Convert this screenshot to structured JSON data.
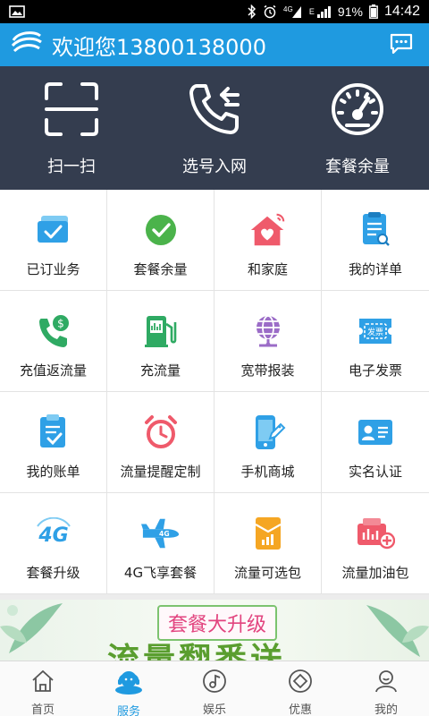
{
  "status_bar": {
    "battery_text": "91%",
    "time": "14:42",
    "signal_label": "4G",
    "network_letter": "E"
  },
  "header": {
    "title": "欢迎您13800138000"
  },
  "hero": {
    "items": [
      {
        "label": "扫一扫",
        "icon": "scan-icon"
      },
      {
        "label": "选号入网",
        "icon": "phone-incoming-icon"
      },
      {
        "label": "套餐余量",
        "icon": "speedometer-icon"
      }
    ]
  },
  "grid": {
    "items": [
      {
        "label": "已订业务",
        "icon": "subscribed-icon"
      },
      {
        "label": "套餐余量",
        "icon": "check-circle-icon"
      },
      {
        "label": "和家庭",
        "icon": "home-heart-icon"
      },
      {
        "label": "我的详单",
        "icon": "bill-detail-icon"
      },
      {
        "label": "充值返流量",
        "icon": "phone-money-icon"
      },
      {
        "label": "充流量",
        "icon": "fuel-pump-icon"
      },
      {
        "label": "宽带报装",
        "icon": "globe-icon"
      },
      {
        "label": "电子发票",
        "icon": "invoice-icon"
      },
      {
        "label": "我的账单",
        "icon": "account-bill-icon"
      },
      {
        "label": "流量提醒定制",
        "icon": "alarm-clock-icon"
      },
      {
        "label": "手机商城",
        "icon": "mobile-shop-icon"
      },
      {
        "label": "实名认证",
        "icon": "id-card-icon"
      },
      {
        "label": "套餐升级",
        "icon": "4g-icon"
      },
      {
        "label": "4G飞享套餐",
        "icon": "airplane-icon"
      },
      {
        "label": "流量可选包",
        "icon": "data-package-icon"
      },
      {
        "label": "流量加油包",
        "icon": "data-boost-icon"
      }
    ]
  },
  "banner": {
    "tag": "套餐大升级",
    "headline": "流量翻番送"
  },
  "tabbar": {
    "items": [
      {
        "label": "首页",
        "icon": "home-icon"
      },
      {
        "label": "服务",
        "icon": "service-icon"
      },
      {
        "label": "娱乐",
        "icon": "music-icon"
      },
      {
        "label": "优惠",
        "icon": "discount-icon"
      },
      {
        "label": "我的",
        "icon": "user-icon"
      }
    ],
    "active_index": 1
  },
  "colors": {
    "header_blue": "#1f9ae0",
    "hero_dark": "#343d4f",
    "active_tab": "#1f9ae0"
  }
}
